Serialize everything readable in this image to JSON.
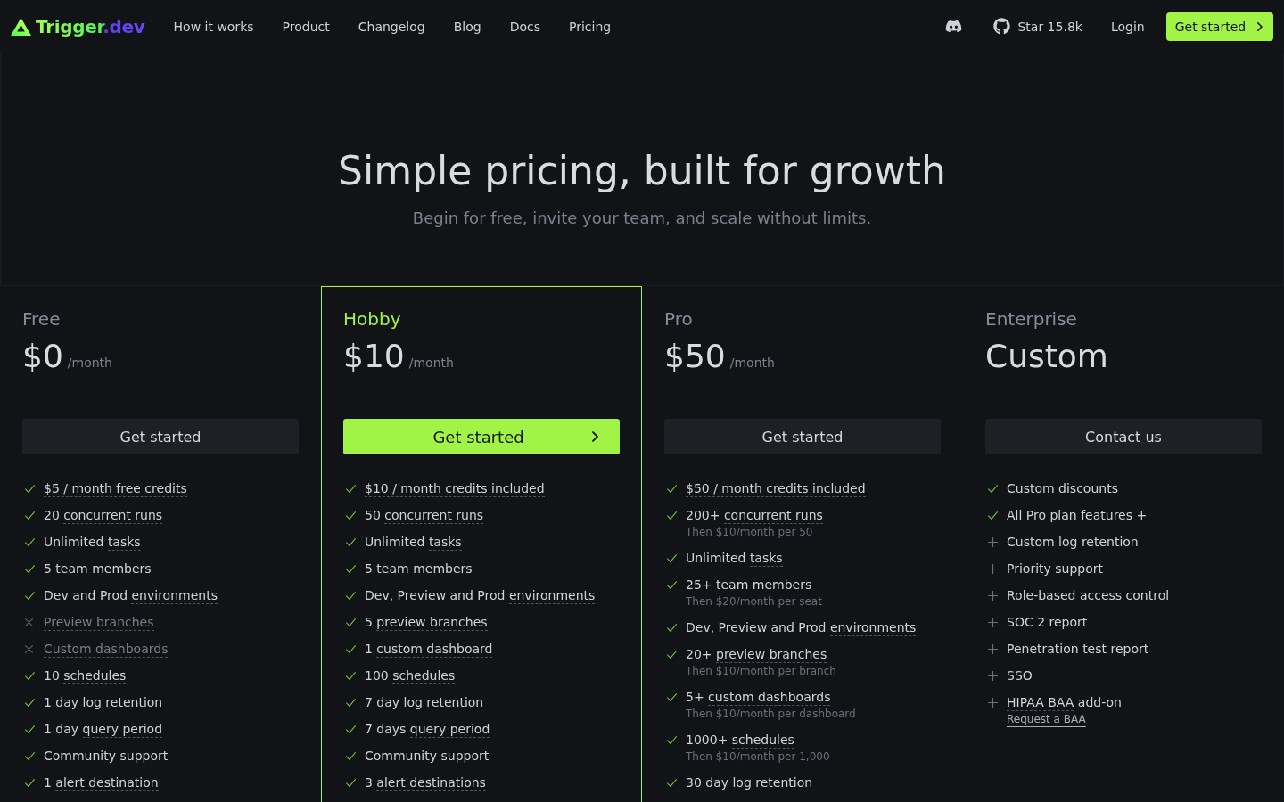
{
  "header": {
    "logo": "Trigger.dev",
    "nav": [
      "How it works",
      "Product",
      "Changelog",
      "Blog",
      "Docs",
      "Pricing"
    ],
    "github_stars": "Star 15.8k",
    "login": "Login",
    "cta": "Get started"
  },
  "hero": {
    "title": "Simple pricing, built for growth",
    "subtitle": "Begin for free, invite your team, and scale without limits."
  },
  "plans": [
    {
      "name": "Free",
      "price": "$0",
      "period": "/month",
      "highlighted": false,
      "button": "Get started",
      "features": [
        {
          "kind": "included",
          "label": [
            {
              "text": "$5 / month free credits",
              "dotted": true
            }
          ]
        },
        {
          "kind": "included",
          "label": [
            {
              "text": "20 ",
              "dotted": false
            },
            {
              "text": "concurrent runs",
              "dotted": true
            }
          ]
        },
        {
          "kind": "included",
          "label": [
            {
              "text": "Unlimited ",
              "dotted": false
            },
            {
              "text": "tasks",
              "dotted": true
            }
          ]
        },
        {
          "kind": "included",
          "label": [
            {
              "text": "5 team members",
              "dotted": false
            }
          ]
        },
        {
          "kind": "included",
          "label": [
            {
              "text": "Dev and Prod ",
              "dotted": false
            },
            {
              "text": "environments",
              "dotted": true
            }
          ]
        },
        {
          "kind": "excluded",
          "label": [
            {
              "text": "Preview branches",
              "dotted": true
            }
          ]
        },
        {
          "kind": "excluded",
          "label": [
            {
              "text": "Custom dashboards",
              "dotted": true
            }
          ]
        },
        {
          "kind": "included",
          "label": [
            {
              "text": "10 ",
              "dotted": false
            },
            {
              "text": "schedules",
              "dotted": true
            }
          ]
        },
        {
          "kind": "included",
          "label": [
            {
              "text": "1 day log retention",
              "dotted": false
            }
          ]
        },
        {
          "kind": "included",
          "label": [
            {
              "text": "1 day ",
              "dotted": false
            },
            {
              "text": "query period",
              "dotted": true
            }
          ]
        },
        {
          "kind": "included",
          "label": [
            {
              "text": "Community support",
              "dotted": false
            }
          ]
        },
        {
          "kind": "included",
          "label": [
            {
              "text": "1 ",
              "dotted": false
            },
            {
              "text": "alert destination",
              "dotted": true
            }
          ]
        }
      ]
    },
    {
      "name": "Hobby",
      "price": "$10",
      "period": "/month",
      "highlighted": true,
      "button": "Get started",
      "features": [
        {
          "kind": "included",
          "label": [
            {
              "text": "$10 / month credits included",
              "dotted": true
            }
          ]
        },
        {
          "kind": "included",
          "label": [
            {
              "text": "50 ",
              "dotted": false
            },
            {
              "text": "concurrent runs",
              "dotted": true
            }
          ]
        },
        {
          "kind": "included",
          "label": [
            {
              "text": "Unlimited ",
              "dotted": false
            },
            {
              "text": "tasks",
              "dotted": true
            }
          ]
        },
        {
          "kind": "included",
          "label": [
            {
              "text": "5 team members",
              "dotted": false
            }
          ]
        },
        {
          "kind": "included",
          "label": [
            {
              "text": "Dev, Preview and Prod ",
              "dotted": false
            },
            {
              "text": "environments",
              "dotted": true
            }
          ]
        },
        {
          "kind": "included",
          "label": [
            {
              "text": "5 ",
              "dotted": false
            },
            {
              "text": "preview branches",
              "dotted": true
            }
          ]
        },
        {
          "kind": "included",
          "label": [
            {
              "text": "1 ",
              "dotted": false
            },
            {
              "text": "custom dashboard",
              "dotted": true
            }
          ]
        },
        {
          "kind": "included",
          "label": [
            {
              "text": "100 ",
              "dotted": false
            },
            {
              "text": "schedules",
              "dotted": true
            }
          ]
        },
        {
          "kind": "included",
          "label": [
            {
              "text": "7 day log retention",
              "dotted": false
            }
          ]
        },
        {
          "kind": "included",
          "label": [
            {
              "text": "7 days ",
              "dotted": false
            },
            {
              "text": "query period",
              "dotted": true
            }
          ]
        },
        {
          "kind": "included",
          "label": [
            {
              "text": "Community support",
              "dotted": false
            }
          ]
        },
        {
          "kind": "included",
          "label": [
            {
              "text": "3 ",
              "dotted": false
            },
            {
              "text": "alert destinations",
              "dotted": true
            }
          ]
        }
      ]
    },
    {
      "name": "Pro",
      "price": "$50",
      "period": "/month",
      "highlighted": false,
      "button": "Get started",
      "features": [
        {
          "kind": "included",
          "label": [
            {
              "text": "$50 / month credits included",
              "dotted": true
            }
          ]
        },
        {
          "kind": "included",
          "label": [
            {
              "text": "200+ ",
              "dotted": false
            },
            {
              "text": "concurrent runs",
              "dotted": true
            }
          ],
          "note": "Then $10/month per 50"
        },
        {
          "kind": "included",
          "label": [
            {
              "text": "Unlimited ",
              "dotted": false
            },
            {
              "text": "tasks",
              "dotted": true
            }
          ]
        },
        {
          "kind": "included",
          "label": [
            {
              "text": "25+ team members",
              "dotted": false
            }
          ],
          "note": "Then $20/month per seat"
        },
        {
          "kind": "included",
          "label": [
            {
              "text": "Dev, Preview and Prod ",
              "dotted": false
            },
            {
              "text": "environments",
              "dotted": true
            }
          ]
        },
        {
          "kind": "included",
          "label": [
            {
              "text": "20+ ",
              "dotted": false
            },
            {
              "text": "preview branches",
              "dotted": true
            }
          ],
          "note": "Then $10/month per branch"
        },
        {
          "kind": "included",
          "label": [
            {
              "text": "5+ ",
              "dotted": false
            },
            {
              "text": "custom dashboards",
              "dotted": true
            }
          ],
          "note": "Then $10/month per dashboard"
        },
        {
          "kind": "included",
          "label": [
            {
              "text": "1000+ ",
              "dotted": false
            },
            {
              "text": "schedules",
              "dotted": true
            }
          ],
          "note": "Then $10/month per 1,000"
        },
        {
          "kind": "included",
          "label": [
            {
              "text": "30 day log retention",
              "dotted": false
            }
          ]
        }
      ]
    },
    {
      "name": "Enterprise",
      "price": "Custom",
      "highlighted": false,
      "button": "Contact us",
      "features": [
        {
          "kind": "included",
          "label": [
            {
              "text": "Custom discounts",
              "dotted": false
            }
          ]
        },
        {
          "kind": "included",
          "label": [
            {
              "text": "All Pro plan features +",
              "dotted": false
            }
          ]
        },
        {
          "kind": "addon",
          "label": [
            {
              "text": "Custom log retention",
              "dotted": false
            }
          ]
        },
        {
          "kind": "addon",
          "label": [
            {
              "text": "Priority support",
              "dotted": false
            }
          ]
        },
        {
          "kind": "addon",
          "label": [
            {
              "text": "Role-based access control",
              "dotted": false
            }
          ]
        },
        {
          "kind": "addon",
          "label": [
            {
              "text": "SOC 2 report",
              "dotted": false
            }
          ]
        },
        {
          "kind": "addon",
          "label": [
            {
              "text": "Penetration test report",
              "dotted": false
            }
          ]
        },
        {
          "kind": "addon",
          "label": [
            {
              "text": "SSO",
              "dotted": false
            }
          ]
        },
        {
          "kind": "addon",
          "label": [
            {
              "text": "HIPAA BAA",
              "dotted": true
            },
            {
              "text": " add-on",
              "dotted": false
            }
          ],
          "link": "Request a BAA"
        }
      ]
    }
  ]
}
